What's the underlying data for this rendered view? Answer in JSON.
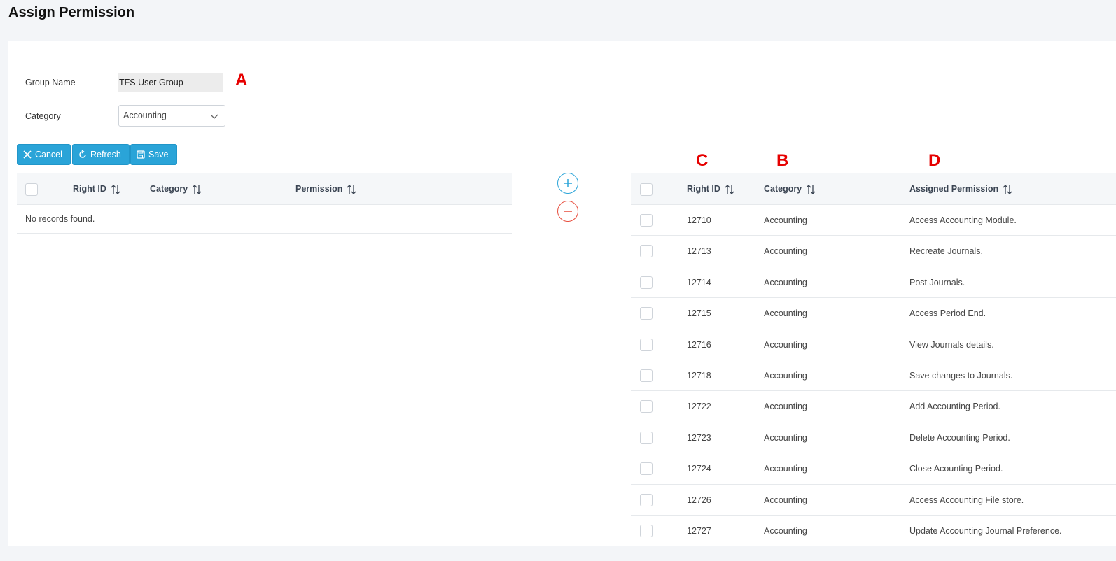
{
  "page": {
    "title": "Assign Permission"
  },
  "form": {
    "group_name_label": "Group Name",
    "group_name_value": "TFS User Group",
    "category_label": "Category",
    "category_value": "Accounting"
  },
  "annotations": {
    "a": "A",
    "b": "B",
    "c": "C",
    "d": "D"
  },
  "toolbar": {
    "cancel_label": "Cancel",
    "refresh_label": "Refresh",
    "save_label": "Save"
  },
  "available_table": {
    "columns": [
      "Right ID",
      "Category",
      "Permission"
    ],
    "empty_message": "No records found."
  },
  "assigned_table": {
    "columns": [
      "Right ID",
      "Category",
      "Assigned Permission"
    ],
    "rows": [
      {
        "id": "12710",
        "category": "Accounting",
        "permission": "Access Accounting Module."
      },
      {
        "id": "12713",
        "category": "Accounting",
        "permission": "Recreate Journals."
      },
      {
        "id": "12714",
        "category": "Accounting",
        "permission": "Post Journals."
      },
      {
        "id": "12715",
        "category": "Accounting",
        "permission": "Access Period End."
      },
      {
        "id": "12716",
        "category": "Accounting",
        "permission": "View Journals details."
      },
      {
        "id": "12718",
        "category": "Accounting",
        "permission": "Save changes to Journals."
      },
      {
        "id": "12722",
        "category": "Accounting",
        "permission": "Add Accounting Period."
      },
      {
        "id": "12723",
        "category": "Accounting",
        "permission": "Delete Accounting Period."
      },
      {
        "id": "12724",
        "category": "Accounting",
        "permission": "Close Acounting Period."
      },
      {
        "id": "12726",
        "category": "Accounting",
        "permission": "Access Accounting File store."
      },
      {
        "id": "12727",
        "category": "Accounting",
        "permission": "Update Accounting Journal Preference."
      }
    ]
  },
  "icons": {
    "cancel": "close-icon",
    "refresh": "refresh-icon",
    "save": "save-icon",
    "add": "plus-circle-icon",
    "remove": "minus-circle-icon",
    "sort": "sort-icon",
    "dropdown": "chevron-down-icon"
  },
  "colors": {
    "primary_button": "#2aa4d8",
    "add_circle": "#2aa4d8",
    "remove_circle": "#e74c3c",
    "annotation": "#e60000"
  }
}
